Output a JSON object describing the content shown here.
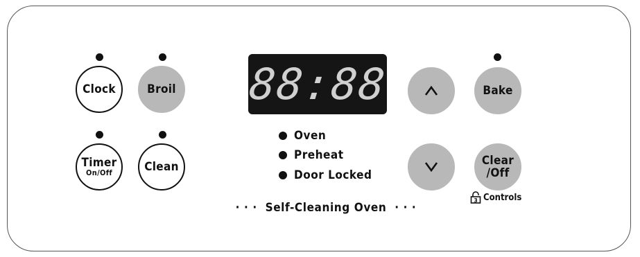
{
  "buttons": {
    "clock": "Clock",
    "broil": "Broil",
    "timer_main": "Timer",
    "timer_sub": "On/Off",
    "clean": "Clean",
    "bake": "Bake",
    "clear_main": "Clear",
    "clear_sub": "/Off"
  },
  "display": {
    "value": "88:88"
  },
  "indicators": [
    "Oven",
    "Preheat",
    "Door Locked"
  ],
  "footer": "· · ·  Self-Cleaning Oven  · · ·",
  "lock": {
    "number": "3",
    "label": "Controls"
  },
  "icons": {
    "up": "chevron-up-icon",
    "down": "chevron-down-icon",
    "lock": "lock-icon"
  },
  "colors": {
    "grey_button": "#b8b8b8",
    "display_bg": "#151515",
    "display_text": "#d0d0d0"
  }
}
